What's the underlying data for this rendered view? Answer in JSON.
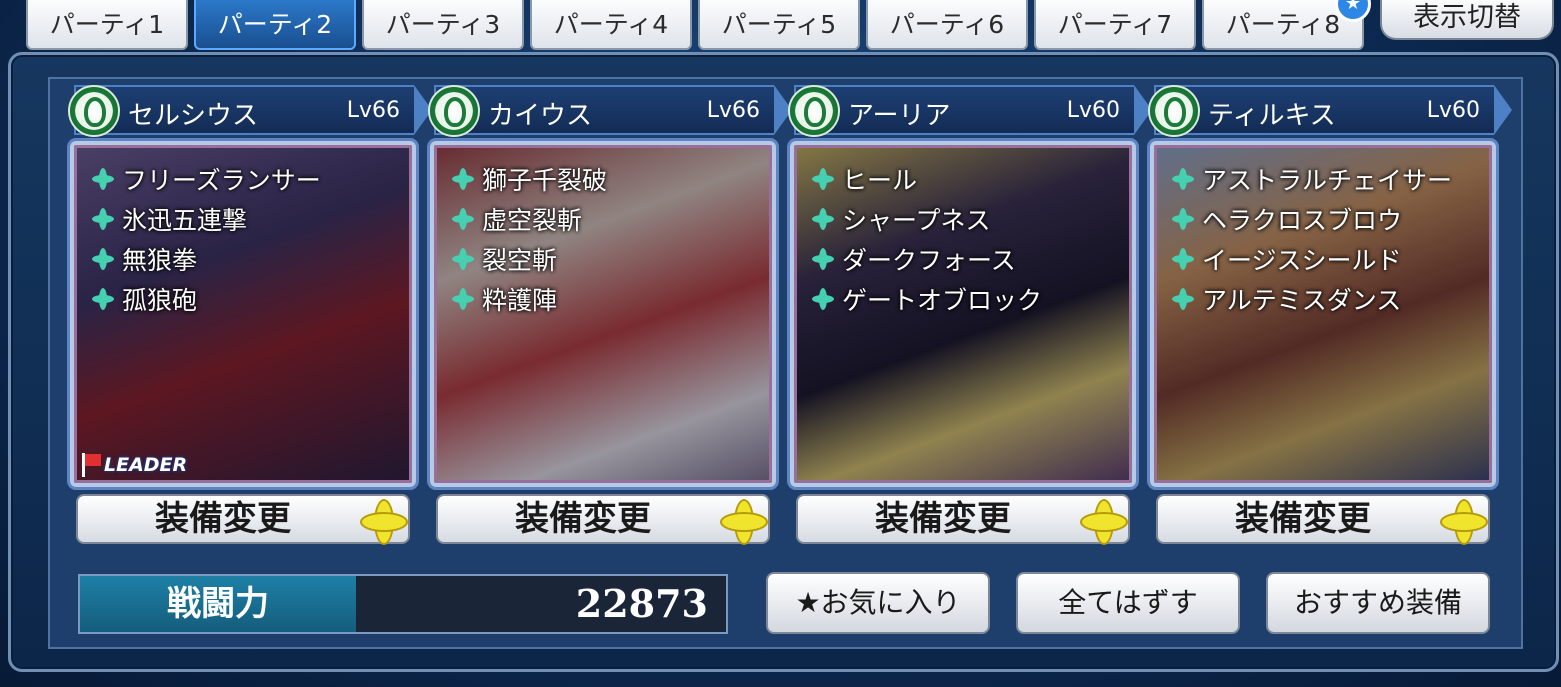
{
  "tabs": [
    {
      "label": "パーティ1"
    },
    {
      "label": "パーティ2"
    },
    {
      "label": "パーティ3"
    },
    {
      "label": "パーティ4"
    },
    {
      "label": "パーティ5"
    },
    {
      "label": "パーティ6"
    },
    {
      "label": "パーティ7"
    },
    {
      "label": "パーティ8"
    }
  ],
  "active_tab": "パーティ2",
  "toggle_label": "表示切替",
  "characters": [
    {
      "name": "セルシウス",
      "level": "Lv66",
      "leader": "LEADER",
      "skills": [
        "フリーズランサー",
        "氷迅五連撃",
        "無狼拳",
        "孤狼砲"
      ]
    },
    {
      "name": "カイウス",
      "level": "Lv66",
      "skills": [
        "獅子千裂破",
        "虚空裂斬",
        "裂空斬",
        "粋護陣"
      ]
    },
    {
      "name": "アーリア",
      "level": "Lv60",
      "skills": [
        "ヒール",
        "シャープネス",
        "ダークフォース",
        "ゲートオブロック"
      ]
    },
    {
      "name": "ティルキス",
      "level": "Lv60",
      "skills": [
        "アストラルチェイサー",
        "ヘラクロスブロウ",
        "イージスシールド",
        "アルテミスダンス"
      ]
    }
  ],
  "equip_label": "装備変更",
  "power": {
    "label": "戦闘力",
    "value": "22873"
  },
  "actions": {
    "favorite": "★お気に入り",
    "remove_all": "全てはずす",
    "recommended": "おすすめ装備"
  },
  "colors": {
    "active_tab": "#2b78c9",
    "skill_icon": "#46d0b2",
    "equip_icon": "#f1e42c",
    "power_label_bg": "#1e7fa6",
    "emblem": "#1c7a3a"
  }
}
